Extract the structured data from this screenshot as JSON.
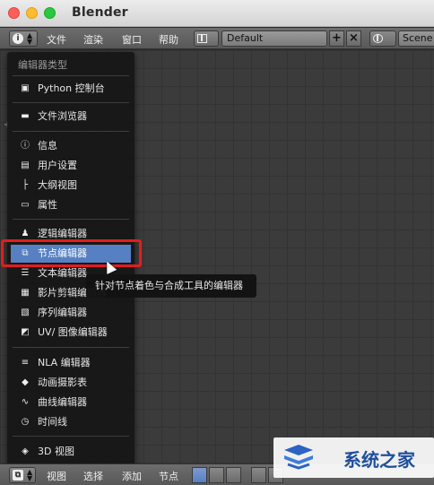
{
  "window": {
    "title": "Blender"
  },
  "header": {
    "menus": [
      "文件",
      "渲染",
      "窗口",
      "帮助"
    ],
    "layout_value": "Default",
    "scene_value": "Scene"
  },
  "dropdown": {
    "title": "编辑器类型",
    "items": [
      {
        "label": "Python 控制台",
        "icon": "python-console-icon"
      },
      {
        "label": "文件浏览器",
        "icon": "file-browser-icon"
      },
      {
        "label": "信息",
        "icon": "info-icon"
      },
      {
        "label": "用户设置",
        "icon": "user-prefs-icon"
      },
      {
        "label": "大纲视图",
        "icon": "outliner-icon"
      },
      {
        "label": "属性",
        "icon": "properties-icon"
      },
      {
        "label": "逻辑编辑器",
        "icon": "logic-editor-icon"
      },
      {
        "label": "节点编辑器",
        "icon": "node-editor-icon"
      },
      {
        "label": "文本编辑器",
        "icon": "text-editor-icon"
      },
      {
        "label": "影片剪辑编辑器",
        "icon": "clip-editor-icon"
      },
      {
        "label": "序列编辑器",
        "icon": "sequence-editor-icon"
      },
      {
        "label": "UV/ 图像编辑器",
        "icon": "image-editor-icon"
      },
      {
        "label": "NLA 编辑器",
        "icon": "nla-icon"
      },
      {
        "label": "动画摄影表",
        "icon": "dopesheet-icon"
      },
      {
        "label": "曲线编辑器",
        "icon": "graph-editor-icon"
      },
      {
        "label": "时间线",
        "icon": "timeline-icon"
      },
      {
        "label": "3D 视图",
        "icon": "view3d-icon"
      }
    ],
    "selected_label": "节点编辑器"
  },
  "tooltip": {
    "text": "针对节点着色与合成工具的编辑器"
  },
  "bottombar": {
    "menus": [
      "视图",
      "选择",
      "添加",
      "节点"
    ]
  },
  "watermark": {
    "text": "系统之家"
  },
  "colors": {
    "selection": "#5680c2",
    "highlight_box": "#e21d1d"
  }
}
